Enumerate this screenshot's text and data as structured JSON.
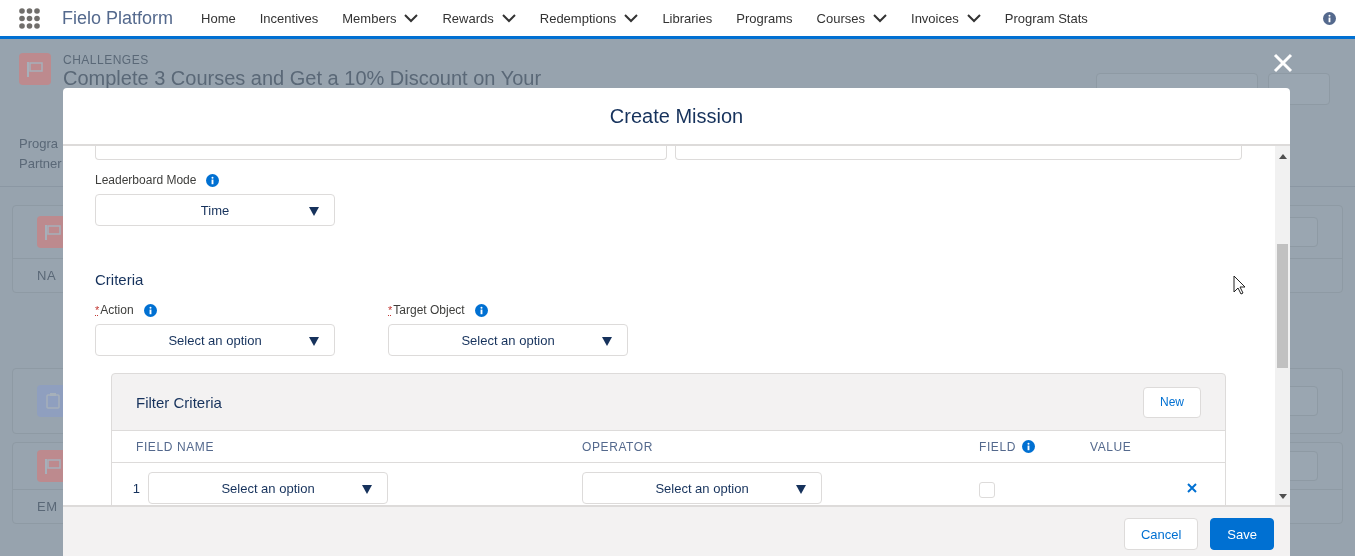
{
  "nav": {
    "app_name": "Fielo Platform",
    "items": [
      {
        "label": "Home",
        "menu": false
      },
      {
        "label": "Incentives",
        "menu": false
      },
      {
        "label": "Members",
        "menu": true
      },
      {
        "label": "Rewards",
        "menu": true
      },
      {
        "label": "Redemptions",
        "menu": true
      },
      {
        "label": "Libraries",
        "menu": false
      },
      {
        "label": "Programs",
        "menu": false
      },
      {
        "label": "Courses",
        "menu": true
      },
      {
        "label": "Invoices",
        "menu": true
      },
      {
        "label": "Program Stats",
        "menu": false
      }
    ]
  },
  "background": {
    "eyebrow": "CHALLENGES",
    "title": "Complete 3 Courses and Get a 10% Discount on Your",
    "details": [
      "Progra",
      "Partner"
    ],
    "cards": [
      {
        "kind": "flag",
        "column_1": "NA"
      },
      {
        "kind": "clipboard"
      },
      {
        "kind": "flag",
        "column_1": "EM"
      }
    ]
  },
  "modal": {
    "title": "Create Mission",
    "leaderboard": {
      "label": "Leaderboard Mode",
      "value": "Time"
    },
    "criteria": {
      "title": "Criteria",
      "fields": [
        {
          "label": "Action",
          "required_mark": "*",
          "value": "Select an option"
        },
        {
          "label": "Target Object",
          "required_mark": "*",
          "value": "Select an option"
        }
      ]
    },
    "filter": {
      "title": "Filter Criteria",
      "new_button": "New",
      "columns": [
        {
          "label": "FIELD NAME",
          "info": false
        },
        {
          "label": "OPERATOR",
          "info": false
        },
        {
          "label": "FIELD",
          "info": true
        },
        {
          "label": "VALUE",
          "info": false
        }
      ],
      "rows": [
        {
          "number": "1",
          "field_name": "Select an option",
          "operator": "Select an option",
          "field_checked": false
        }
      ]
    },
    "buttons": [
      {
        "label": "Cancel",
        "kind": "neutral"
      },
      {
        "label": "Save",
        "kind": "brand"
      }
    ]
  }
}
